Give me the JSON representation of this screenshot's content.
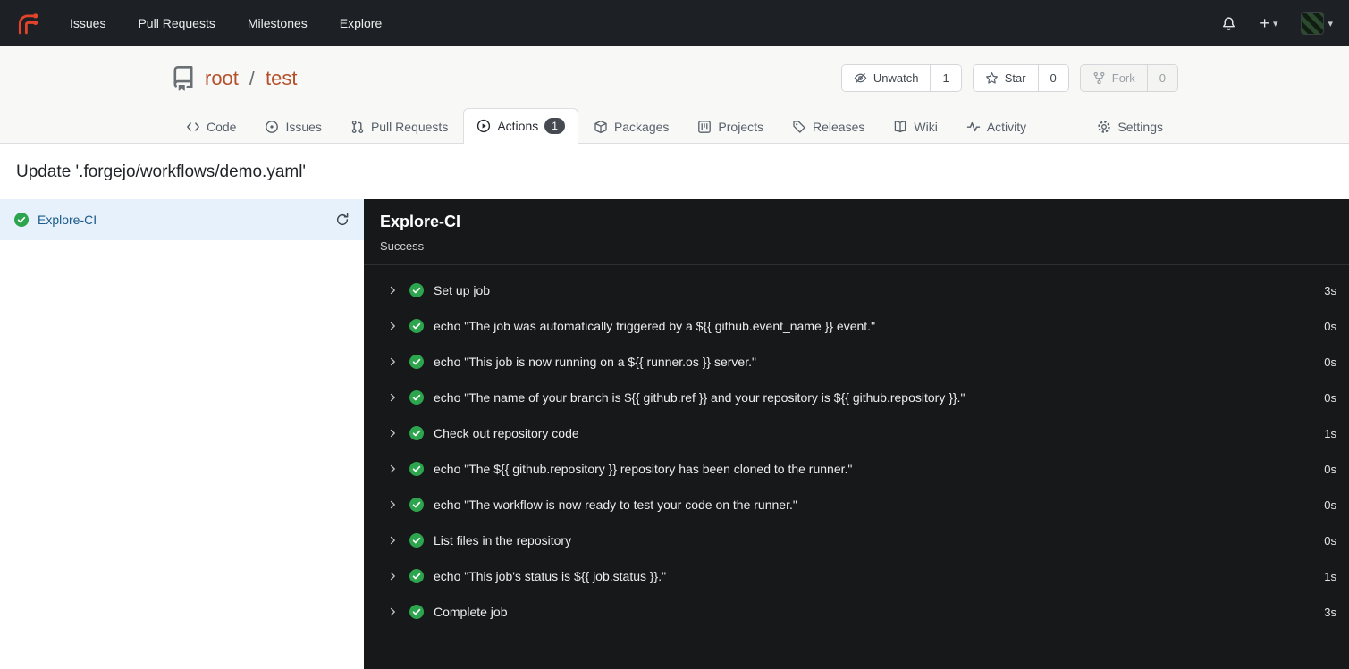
{
  "colors": {
    "brand": "#e2432a",
    "success_green": "#2da44e",
    "selected_job_bg": "#e7f1fb",
    "panel_bg": "#161819",
    "repo_link": "#b5502b"
  },
  "glyphs": {
    "caret": "▾",
    "plus": "+"
  },
  "navbar": {
    "items": [
      {
        "label": "Issues"
      },
      {
        "label": "Pull Requests"
      },
      {
        "label": "Milestones"
      },
      {
        "label": "Explore"
      }
    ]
  },
  "repo_header": {
    "owner": "root",
    "separator": "/",
    "name": "test",
    "actions": {
      "unwatch": {
        "label": "Unwatch",
        "count": "1"
      },
      "star": {
        "label": "Star",
        "count": "0"
      },
      "fork": {
        "label": "Fork",
        "count": "0"
      }
    }
  },
  "tabs": [
    {
      "label": "Code"
    },
    {
      "label": "Issues"
    },
    {
      "label": "Pull Requests"
    },
    {
      "label": "Actions",
      "badge": "1"
    },
    {
      "label": "Packages"
    },
    {
      "label": "Projects"
    },
    {
      "label": "Releases"
    },
    {
      "label": "Wiki"
    },
    {
      "label": "Activity"
    },
    {
      "label": "Settings"
    }
  ],
  "run": {
    "title": "Update '.forgejo/workflows/demo.yaml'",
    "job_name": "Explore-CI",
    "panel_title": "Explore-CI",
    "panel_status": "Success"
  },
  "steps": [
    {
      "name": "Set up job",
      "duration": "3s"
    },
    {
      "name": "echo \"The job was automatically triggered by a ${{ github.event_name }} event.\"",
      "duration": "0s"
    },
    {
      "name": "echo \"This job is now running on a ${{ runner.os }} server.\"",
      "duration": "0s"
    },
    {
      "name": "echo \"The name of your branch is ${{ github.ref }} and your repository is ${{ github.repository }}.\"",
      "duration": "0s"
    },
    {
      "name": "Check out repository code",
      "duration": "1s"
    },
    {
      "name": "echo \"The ${{ github.repository }} repository has been cloned to the runner.\"",
      "duration": "0s"
    },
    {
      "name": "echo \"The workflow is now ready to test your code on the runner.\"",
      "duration": "0s"
    },
    {
      "name": "List files in the repository",
      "duration": "0s"
    },
    {
      "name": "echo \"This job's status is ${{ job.status }}.\"",
      "duration": "1s"
    },
    {
      "name": "Complete job",
      "duration": "3s"
    }
  ]
}
